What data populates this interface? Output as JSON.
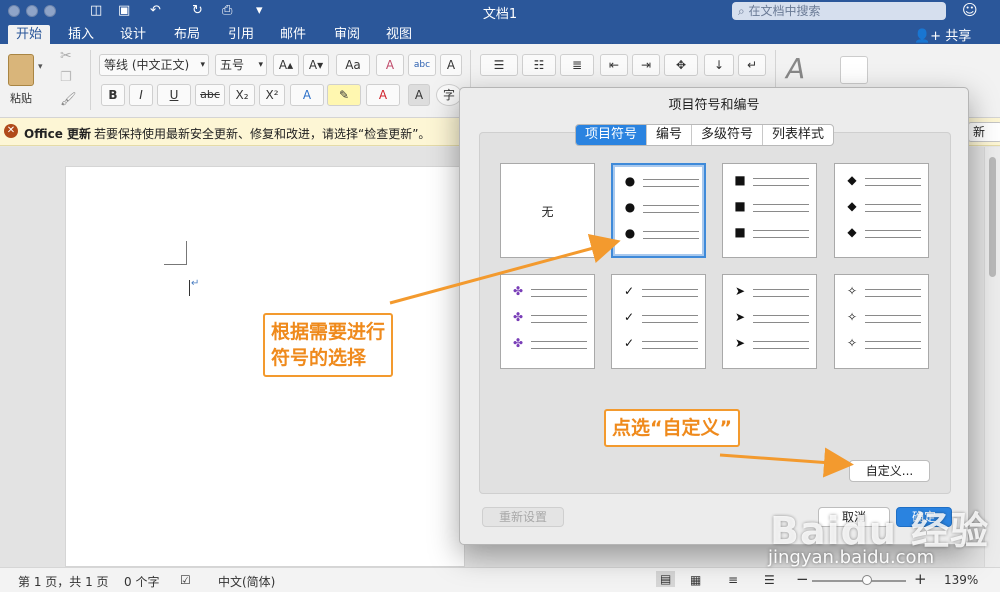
{
  "titlebar": {
    "doc_title": "文档1",
    "search_placeholder": "在文档中搜索",
    "quick_access": [
      "◫",
      "▣",
      "↶",
      "↻",
      "⎙",
      "▾"
    ]
  },
  "tabs": [
    "开始",
    "插入",
    "设计",
    "布局",
    "引用",
    "邮件",
    "审阅",
    "视图"
  ],
  "share_label": "共享",
  "ribbon": {
    "paste_label": "粘贴",
    "font_name": "等线 (中文正文)",
    "font_size": "五号",
    "grow_font": "A▴",
    "shrink_font": "A▾",
    "change_case": "Aa",
    "clear_format": "A",
    "phonetic": "abc",
    "char_border": "A",
    "bold": "B",
    "italic": "I",
    "underline": "U",
    "strike": "abc",
    "subscript": "X₂",
    "superscript": "X²",
    "text_effect": "A",
    "highlight": "✎",
    "font_color": "A",
    "char_shading": "A",
    "enclose": "字"
  },
  "update_bar": {
    "title": "Office 更新",
    "message": "若要保持使用最新安全更新、修复和改进，请选择“检查更新”。",
    "button": "新"
  },
  "statusbar": {
    "page": "第 1 页，共 1 页",
    "words": "0 个字",
    "language": "中文(简体)",
    "zoom": "139%",
    "zoom_fraction": 0.58
  },
  "dialog": {
    "title": "项目符号和编号",
    "tabs": [
      "项目符号",
      "编号",
      "多级符号",
      "列表样式"
    ],
    "active_tab": 0,
    "bullets": [
      {
        "symbol": "",
        "label": "无"
      },
      {
        "symbol": "●",
        "label": ""
      },
      {
        "symbol": "■",
        "label": ""
      },
      {
        "symbol": "◆",
        "label": ""
      },
      {
        "symbol": "✤",
        "label": ""
      },
      {
        "symbol": "✓",
        "label": ""
      },
      {
        "symbol": "➤",
        "label": ""
      },
      {
        "symbol": "✧",
        "label": ""
      }
    ],
    "selected_index": 1,
    "custom_button": "自定义...",
    "reset_button": "重新设置",
    "cancel_button": "取消",
    "ok_button": "确定"
  },
  "annotations": {
    "note1": [
      "根据需要进行",
      "符号的选择"
    ],
    "note2": "点选“自定义”",
    "color": "#f39a2e"
  },
  "watermark": {
    "brand": "Baidu 经验",
    "url": "jingyan.baidu.com"
  }
}
